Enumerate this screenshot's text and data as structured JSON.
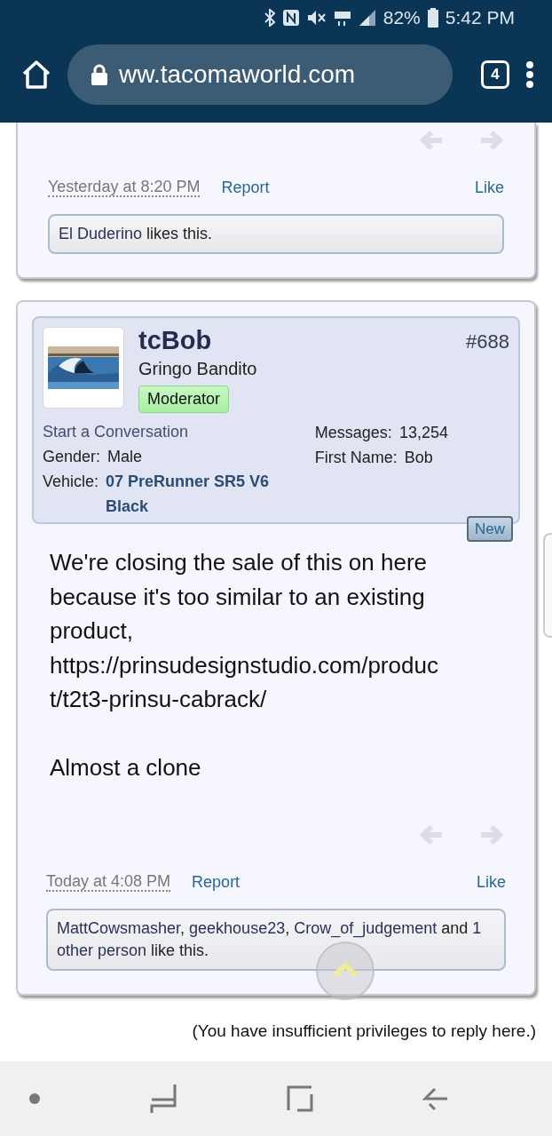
{
  "status_bar": {
    "battery": "82%",
    "time": "5:42 PM"
  },
  "browser": {
    "url": "ww.tacomaworld.com",
    "tab_count": "4"
  },
  "posts": [
    {
      "kind": "partial",
      "date": "Yesterday at 8:20 PM",
      "report": "Report",
      "like": "Like",
      "likes": [
        {
          "kind": "link",
          "text": "El Duderino"
        },
        {
          "kind": "text",
          "text": " likes this."
        }
      ]
    },
    {
      "kind": "full",
      "author": "tcBob",
      "user_title": "Gringo Bandito",
      "role": "Moderator",
      "number": "#688",
      "start_conversation": "Start a Conversation",
      "left_fields": [
        {
          "label": "Gender:",
          "value": "Male",
          "kind": "plain"
        },
        {
          "label": "Vehicle:",
          "value": "07 PreRunner SR5 V6 Black",
          "kind": "link"
        }
      ],
      "right_fields": [
        {
          "label": "Messages:",
          "value": "13,254"
        },
        {
          "label": "First Name:",
          "value": "Bob"
        }
      ],
      "new_badge": "New",
      "body": [
        {
          "kind": "text",
          "text": "We're closing the sale of this on here because it's too similar to an existing product,"
        },
        {
          "kind": "link",
          "text": "https://prinsudesignstudio.com/product/t2t3-prinsu-cabrack/"
        },
        {
          "kind": "gap"
        },
        {
          "kind": "text",
          "text": "Almost a clone"
        }
      ],
      "date": "Today at 4:08 PM",
      "report": "Report",
      "like": "Like",
      "likes": [
        {
          "kind": "link",
          "text": "MattCowsmasher"
        },
        {
          "kind": "text",
          "text": ", "
        },
        {
          "kind": "link",
          "text": "geekhouse23"
        },
        {
          "kind": "text",
          "text": ", "
        },
        {
          "kind": "link",
          "text": "Crow_of_judgement"
        },
        {
          "kind": "text",
          "text": " and "
        },
        {
          "kind": "link",
          "text": "1 other person"
        },
        {
          "kind": "text",
          "text": " like this."
        }
      ]
    }
  ],
  "notice": "(You have insufficient privileges to reply here.)"
}
